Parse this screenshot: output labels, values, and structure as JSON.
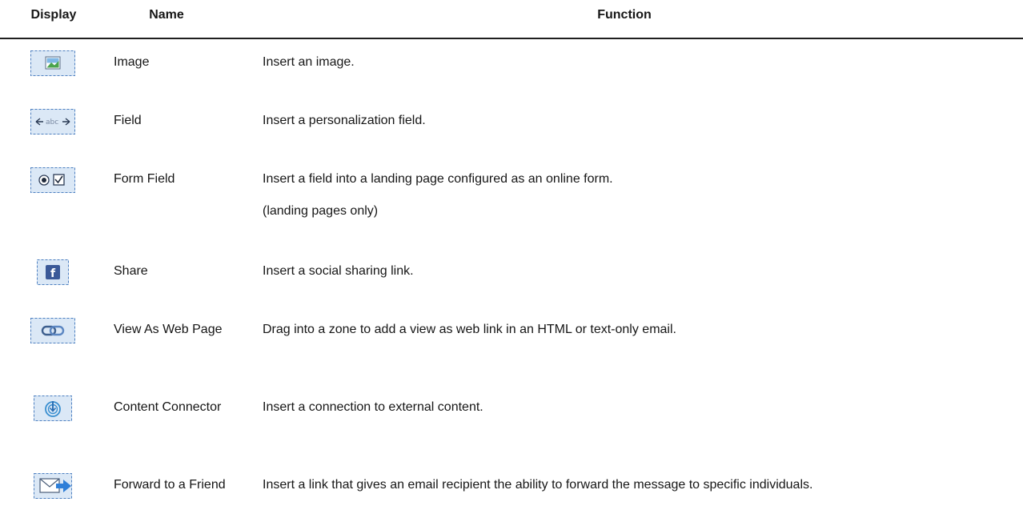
{
  "table": {
    "headers": {
      "display": "Display",
      "name": "Name",
      "function": "Function"
    },
    "rows": [
      {
        "icon": "image-icon",
        "name": "Image",
        "function": [
          "Insert an image."
        ]
      },
      {
        "icon": "field-icon",
        "name": "Field",
        "function": [
          "Insert a personalization field."
        ]
      },
      {
        "icon": "form-field-icon",
        "name": "Form Field",
        "function": [
          "Insert a field into a landing page configured as an online form.",
          "(landing pages only)"
        ]
      },
      {
        "icon": "facebook-share-icon",
        "name": "Share",
        "function": [
          "Insert a social sharing link."
        ]
      },
      {
        "icon": "web-link-icon",
        "name": "View As Web Page",
        "function": [
          "Drag into a zone to add a view as web link in an HTML or text-only email."
        ]
      },
      {
        "icon": "content-connector-icon",
        "name": "Content Connector",
        "function": [
          "Insert a connection to external content."
        ]
      },
      {
        "icon": "forward-email-icon",
        "name": "Forward to a Friend",
        "function": [
          "Insert a link that gives an email recipient the ability to forward the message to specific individuals."
        ]
      }
    ]
  }
}
